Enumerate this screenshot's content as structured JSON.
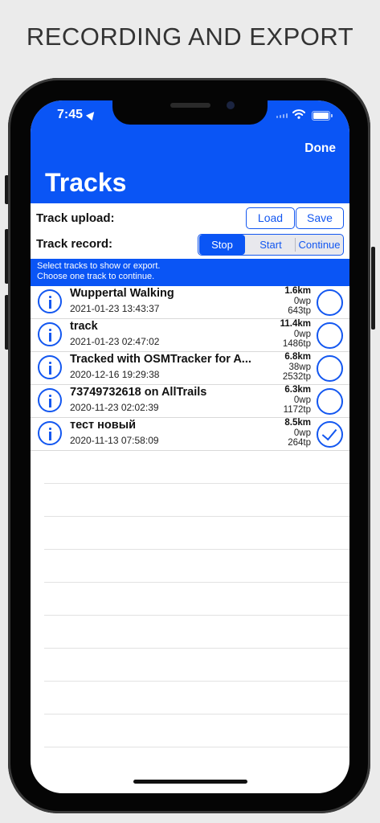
{
  "caption": "RECORDING AND EXPORT",
  "status_bar": {
    "time": "7:45"
  },
  "nav": {
    "done_label": "Done",
    "title": "Tracks"
  },
  "upload": {
    "label": "Track upload:",
    "load_label": "Load",
    "save_label": "Save"
  },
  "record": {
    "label": "Track record:",
    "segments": [
      "Stop",
      "Start",
      "Continue"
    ],
    "selected": "Stop"
  },
  "hint": {
    "line1": "Select tracks to show or export.",
    "line2": "Choose one track to continue."
  },
  "tracks": [
    {
      "name": "Wuppertal Walking",
      "date": "2021-01-23 13:43:37",
      "distance": "1.6km",
      "waypoints": "0wp",
      "trackpoints": "643tp",
      "selected": false
    },
    {
      "name": "track",
      "date": "2021-01-23 02:47:02",
      "distance": "11.4km",
      "waypoints": "0wp",
      "trackpoints": "1486tp",
      "selected": false
    },
    {
      "name": "Tracked with OSMTracker for A...",
      "date": "2020-12-16 19:29:38",
      "distance": "6.8km",
      "waypoints": "38wp",
      "trackpoints": "2532tp",
      "selected": false
    },
    {
      "name": "73749732618 on AllTrails",
      "date": "2020-11-23 02:02:39",
      "distance": "6.3km",
      "waypoints": "0wp",
      "trackpoints": "1172tp",
      "selected": false
    },
    {
      "name": "тест новый",
      "date": "2020-11-13 07:58:09",
      "distance": "8.5km",
      "waypoints": "0wp",
      "trackpoints": "264tp",
      "selected": true
    }
  ],
  "colors": {
    "accent": "#0a55f5",
    "button": "#1357f0"
  },
  "icons": {
    "info": "info-icon",
    "check": "checkmark-icon",
    "select": "radio-circle-icon"
  }
}
